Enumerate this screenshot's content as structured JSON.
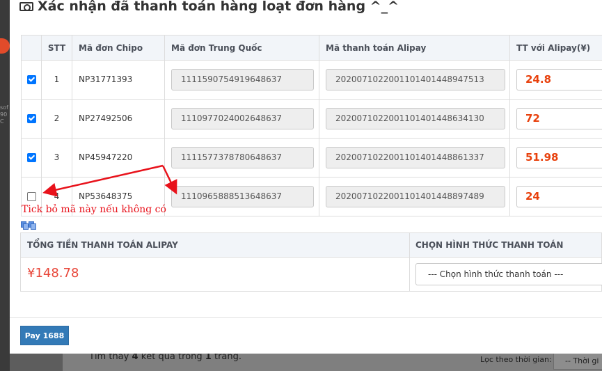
{
  "background": {
    "results_prefix": "Tìm thấy",
    "results_count": "4",
    "results_mid": "kết quả trong",
    "results_pages": "1",
    "results_suffix": "trang.",
    "filter_label": "Lọc theo thời gian:",
    "filter_value": "-- Thời gi"
  },
  "modal": {
    "title": "Xác nhận đã thanh toán hàng loạt đơn hàng ^_^",
    "title_icon": "money-bill-icon"
  },
  "table": {
    "headers": [
      "",
      "STT",
      "Mã đơn Chipo",
      "Mã đơn Trung Quốc",
      "Mã thanh toán Alipay",
      "TT với Alipay(¥)"
    ],
    "rows": [
      {
        "checked": true,
        "stt": "1",
        "chipo": "NP31771393",
        "cn_order": "1111590754919648637",
        "alipay_code": "2020071022001101401448947513",
        "amount": "24.8"
      },
      {
        "checked": true,
        "stt": "2",
        "chipo": "NP27492506",
        "cn_order": "1110977024002648637",
        "alipay_code": "2020071022001101401448634130",
        "amount": "72"
      },
      {
        "checked": true,
        "stt": "3",
        "chipo": "NP45947220",
        "cn_order": "1111577378780648637",
        "alipay_code": "2020071022001101401448861337",
        "amount": "51.98"
      },
      {
        "checked": false,
        "stt": "4",
        "chipo": "NP53648375",
        "cn_order": "1110965888513648637",
        "alipay_code": "2020071022001101401448897489",
        "amount": "24"
      }
    ]
  },
  "annotation": {
    "text": "Tick bỏ mã này nếu không có",
    "color": "#e8121b"
  },
  "summary": {
    "total_label": "TỔNG TIỀN THANH TOÁN ALIPAY",
    "total_value": "¥148.78",
    "method_label": "CHỌN HÌNH THỨC THANH TOÁN",
    "method_placeholder": "--- Chọn hình thức thanh toán ---"
  },
  "footer": {
    "pay_button": "Pay 1688"
  },
  "colors": {
    "accent": "#337ab7",
    "amount": "#e8410d",
    "checkbox": "#0075ff"
  }
}
